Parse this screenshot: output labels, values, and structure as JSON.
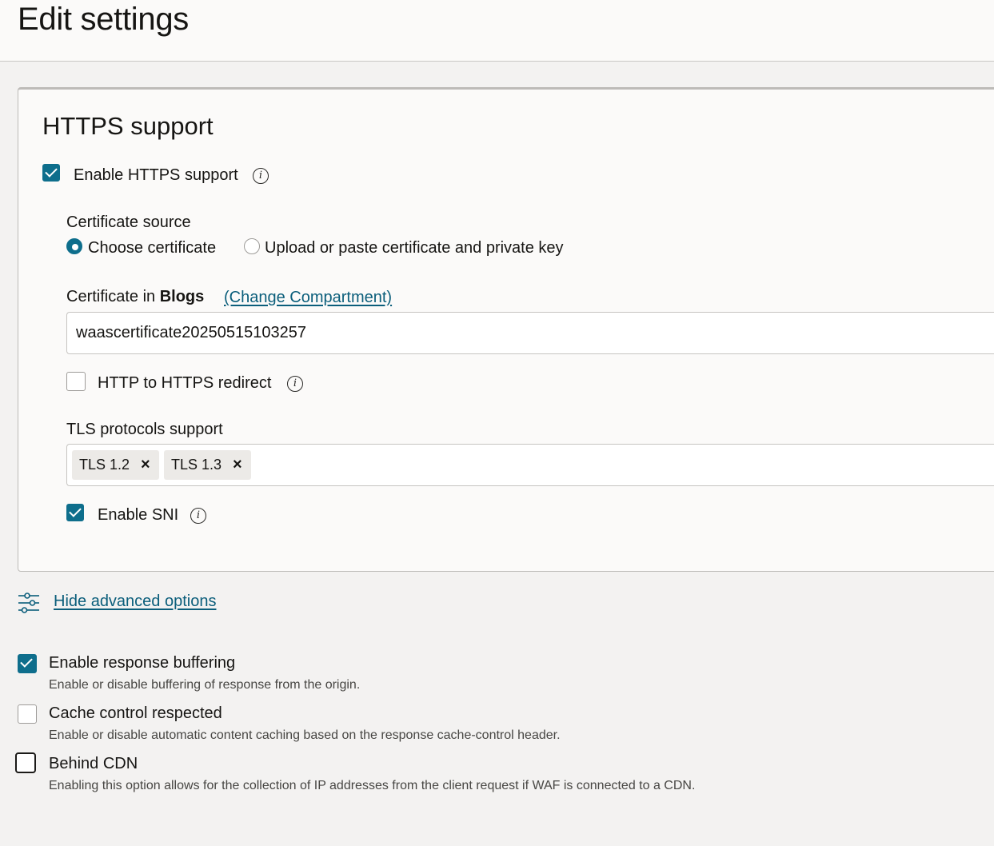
{
  "page": {
    "title": "Edit settings"
  },
  "https_section": {
    "title": "HTTPS support",
    "enable_https": {
      "label": "Enable HTTPS support",
      "checked": true,
      "icon": "info-icon"
    },
    "certificate_source": {
      "label": "Certificate source",
      "options": [
        {
          "label": "Choose certificate",
          "selected": true
        },
        {
          "label": "Upload or paste certificate and private key",
          "selected": false
        }
      ]
    },
    "certificate": {
      "label_prefix": "Certificate in",
      "compartment": "Blogs",
      "change_link": "(Change Compartment)",
      "value": "waascertificate20250515103257"
    },
    "http_redirect": {
      "label": "HTTP to HTTPS redirect",
      "checked": false
    },
    "tls": {
      "label": "TLS protocols support",
      "chips": [
        "TLS 1.2",
        "TLS 1.3"
      ],
      "remove_glyph": "×"
    },
    "enable_sni": {
      "label": "Enable SNI",
      "checked": true
    }
  },
  "advanced": {
    "toggle_label": "Hide advanced options",
    "icon": "sliders-icon",
    "options": [
      {
        "label": "Enable response buffering",
        "description": "Enable or disable buffering of response from the origin.",
        "checked": true
      },
      {
        "label": "Cache control respected",
        "description": "Enable or disable automatic content caching based on the response cache-control header.",
        "checked": false
      },
      {
        "label": "Behind CDN",
        "description": "Enabling this option allows for the collection of IP addresses from the client request if WAF is connected to a CDN.",
        "checked": false
      }
    ]
  },
  "colors": {
    "accent": "#0e6e8c",
    "link": "#0b5e7b",
    "background": "#f3f2f1",
    "panel": "#fbfaf9"
  }
}
